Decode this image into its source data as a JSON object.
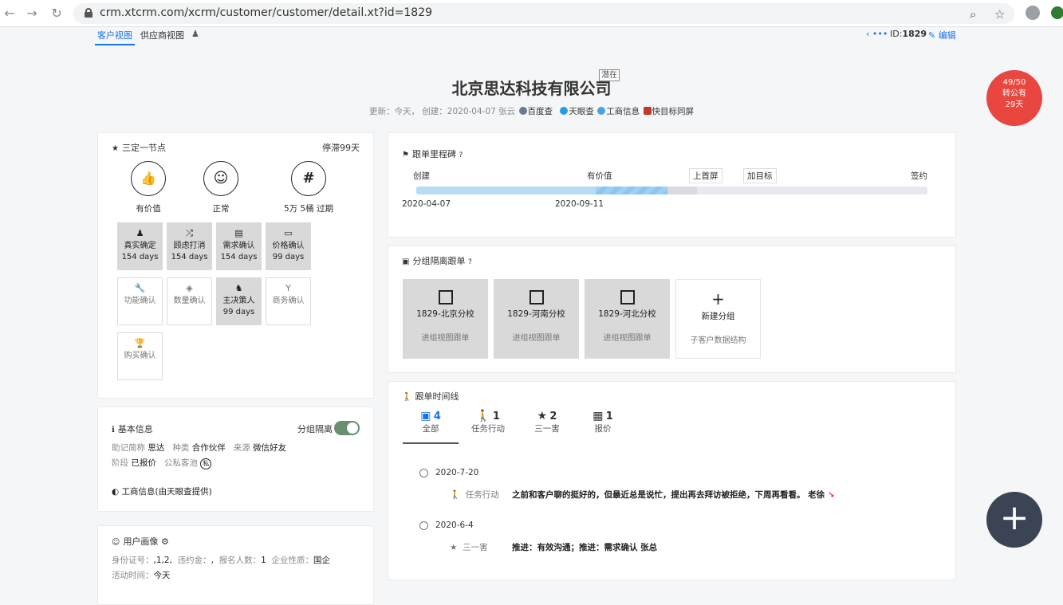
{
  "browser": {
    "url": "crm.xtcrm.com/xcrm/customer/customer/detail.xt?id=1829"
  },
  "topbar": {
    "tabs": [
      "客户视图",
      "供应商视图"
    ],
    "id_label": "ID:",
    "id_value": "1829",
    "edit_label": "编辑",
    "more_label": "•••"
  },
  "header": {
    "company": "北京思达科技有限公司",
    "tag": "潜在",
    "subline_prefix": "更新：今天， 创建：2020-04-07 张云",
    "links": [
      "百度查",
      "天眼查",
      "工商信息",
      "快目标同屏"
    ]
  },
  "badge": {
    "line1": "49/50",
    "line2": "转公有",
    "line3": "29天"
  },
  "nodes": {
    "title": "三定一节点",
    "stagnant": "停滞99天",
    "circles": [
      {
        "icon": "👍",
        "label": "有价值"
      },
      {
        "icon": "☺",
        "label": "正常"
      },
      {
        "icon": "#",
        "label": "5万 5桶 过期"
      }
    ],
    "tiles": [
      {
        "label": "真实确定",
        "days": "154 days",
        "on": true
      },
      {
        "label": "顾虑打消",
        "days": "154 days",
        "on": true
      },
      {
        "label": "需求确认",
        "days": "154 days",
        "on": true
      },
      {
        "label": "价格确认",
        "days": "99 days",
        "on": true
      },
      {
        "label": "功能确认",
        "days": "",
        "on": false
      },
      {
        "label": "数量确认",
        "days": "",
        "on": false
      },
      {
        "label": "主决策人",
        "days": "99 days",
        "on": true
      },
      {
        "label": "商务确认",
        "days": "",
        "on": false
      },
      {
        "label": "购买确认",
        "days": "",
        "on": false
      }
    ]
  },
  "basic": {
    "title": "基本信息",
    "toggle_label": "分组隔离",
    "row1": [
      {
        "k": "助记简称",
        "v": "思达"
      },
      {
        "k": "种类",
        "v": "合作伙伴"
      },
      {
        "k": "来源",
        "v": "微信好友"
      }
    ],
    "row2": [
      {
        "k": "阶段",
        "v": "已报价"
      },
      {
        "k": "公私客池",
        "v": "私"
      }
    ],
    "biz": "工商信息(由天眼查提供)"
  },
  "portrait": {
    "title": "用户画像",
    "row": [
      {
        "k": "身份证号：",
        "v": ",1,2,"
      },
      {
        "k": "违约金：",
        "v": ","
      },
      {
        "k": "报名人数：",
        "v": "1"
      },
      {
        "k": "企业性质：",
        "v": "国企"
      }
    ],
    "row2_k": "活动时间：",
    "row2_v": "今天"
  },
  "milestone": {
    "title": "跟单里程碑",
    "labels": [
      "创建",
      "有价值",
      "签约"
    ],
    "buttons": [
      "上首屏",
      "加目标"
    ],
    "dates": [
      "2020-04-07",
      "2020-09-11"
    ]
  },
  "groups": {
    "title": "分组隔离跟单",
    "items": [
      {
        "name": "1829-北京分校",
        "sub": "进组视图跟单"
      },
      {
        "name": "1829-河南分校",
        "sub": "进组视图跟单"
      },
      {
        "name": "1829-河北分校",
        "sub": "进组视图跟单"
      }
    ],
    "new_label": "新建分组",
    "new_sub": "子客户数据结构"
  },
  "timeline": {
    "title": "跟单时间线",
    "tabs": [
      {
        "icon": "▣",
        "num": "4",
        "label": "全部"
      },
      {
        "icon": "🚶",
        "num": "1",
        "label": "任务行动"
      },
      {
        "icon": "★",
        "num": "2",
        "label": "三一害"
      },
      {
        "icon": "▦",
        "num": "1",
        "label": "报价"
      }
    ],
    "entries": [
      {
        "date": "2020-7-20",
        "type": "任务行动",
        "content": "之前和客户聊的挺好的，但最近总是说忙，提出再去拜访被拒绝，下周再看看。 老徐"
      },
      {
        "date": "2020-6-4",
        "type": "三一害",
        "content": "推进：有效沟通；推进：需求确认 张总"
      }
    ]
  },
  "colors": {
    "accent": "#1a73e8",
    "badge": "#e8463e",
    "fab": "#3a4454"
  }
}
